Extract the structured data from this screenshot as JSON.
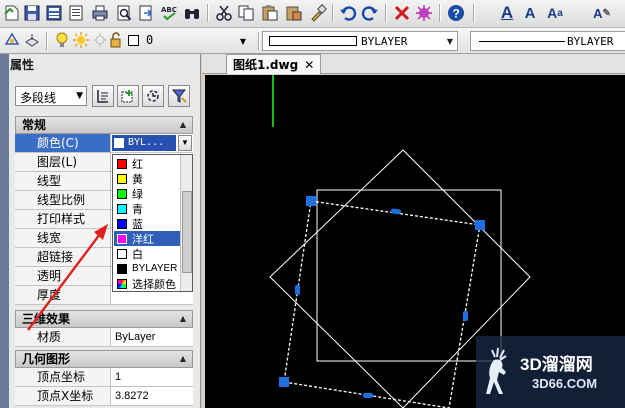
{
  "toolbar2": {
    "layer_name": "0",
    "color_value": "BYLAYER",
    "linetype_value": "BYLAYER"
  },
  "panel": {
    "title": "属性",
    "object_type": "多段线",
    "categories": {
      "general": "常规",
      "three_d": "三维效果",
      "geometry": "几何图形"
    },
    "general_rows": [
      {
        "key": "颜色(C)",
        "value": "BYL..."
      },
      {
        "key": "图层(L)",
        "value": ""
      },
      {
        "key": "线型",
        "value": ""
      },
      {
        "key": "线型比例",
        "value": ""
      },
      {
        "key": "打印样式",
        "value": ""
      },
      {
        "key": "线宽",
        "value": ""
      },
      {
        "key": "超链接",
        "value": ""
      },
      {
        "key": "透明",
        "value": ""
      },
      {
        "key": "厚度",
        "value": ""
      }
    ],
    "three_d_rows": [
      {
        "key": "材质",
        "value": "ByLayer"
      }
    ],
    "geometry_rows": [
      {
        "key": "顶点坐标",
        "value": "1"
      },
      {
        "key": "顶点X坐标",
        "value": "3.8272"
      }
    ]
  },
  "color_dropdown": {
    "items": [
      {
        "label": "红",
        "color": "#ff0000"
      },
      {
        "label": "黄",
        "color": "#ffff00"
      },
      {
        "label": "绿",
        "color": "#00ff00"
      },
      {
        "label": "青",
        "color": "#00ffff"
      },
      {
        "label": "蓝",
        "color": "#0000ff"
      },
      {
        "label": "洋红",
        "color": "#ff00ff",
        "highlighted": true
      },
      {
        "label": "白",
        "color": "#ffffff"
      },
      {
        "label": "BYLAYER",
        "color": "#000000"
      },
      {
        "label": "选择颜色",
        "color": "multi"
      }
    ]
  },
  "document": {
    "tab_label": "图纸1.dwg",
    "close_glyph": "✕"
  },
  "watermark": {
    "line1": "3D溜溜网",
    "line2": "3D66.COM"
  },
  "colors": {
    "selection_blue": "#3a6ec6",
    "grip_blue": "#1e6fe0",
    "canvas": "#000000",
    "annotation_arrow": "#e02020"
  }
}
